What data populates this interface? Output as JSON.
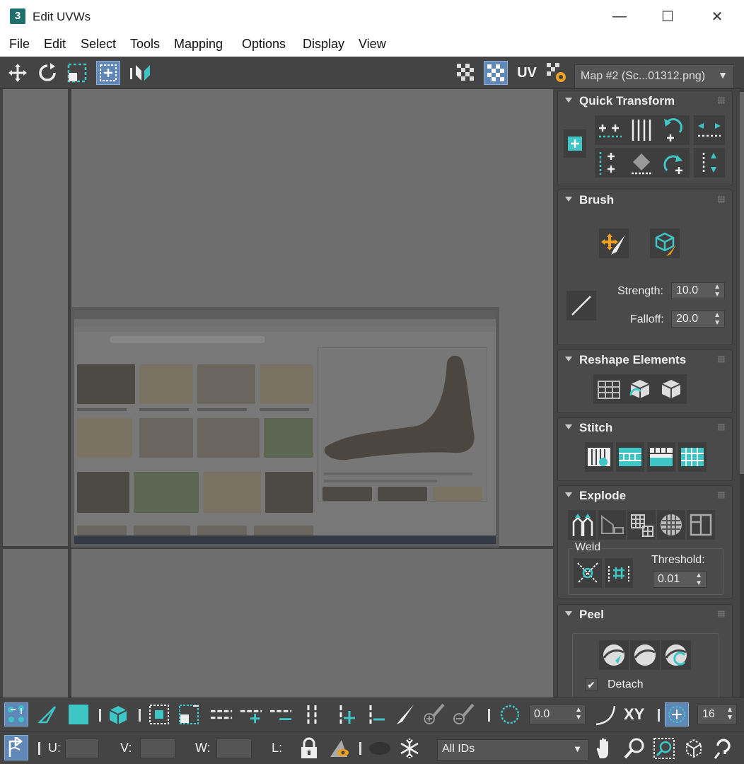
{
  "window": {
    "title": "Edit UVWs",
    "minimize_glyph": "—",
    "maximize_glyph": "☐",
    "close_glyph": "✕",
    "app_icon_label": "3"
  },
  "menu": [
    "File",
    "Edit",
    "Select",
    "Tools",
    "Mapping",
    "Options",
    "Display",
    "View"
  ],
  "toolbar": {
    "uv_label": "UV",
    "map_select": "Map #2 (Sc...01312.png)"
  },
  "panel": {
    "quick_transform": "Quick Transform",
    "brush": "Brush",
    "strength_label": "Strength:",
    "strength_value": "10.0",
    "falloff_label": "Falloff:",
    "falloff_value": "20.0",
    "reshape": "Reshape Elements",
    "stitch": "Stitch",
    "explode": "Explode",
    "weld_label": "Weld",
    "threshold_label": "Threshold:",
    "threshold_value": "0.01",
    "peel": "Peel",
    "detach_label": "Detach"
  },
  "bottom": {
    "angle_value": "0.0",
    "xy_label": "XY",
    "pixels_value": "16",
    "u_label": "U:",
    "v_label": "V:",
    "w_label": "W:",
    "l_label": "L:",
    "ids_select": "All IDs"
  },
  "colors": {
    "accent": "#3ec6c6",
    "active": "#5f87b8",
    "orange": "#f0a020"
  }
}
